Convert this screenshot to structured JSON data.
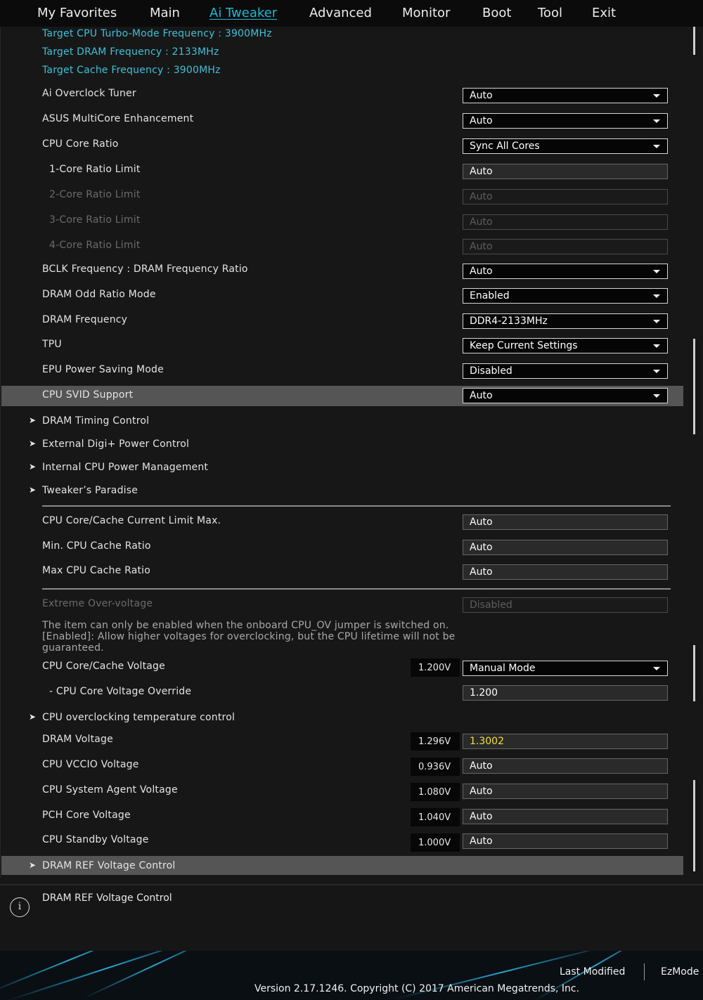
{
  "nav": {
    "tabs": [
      "My Favorites",
      "Main",
      "Ai Tweaker",
      "Advanced",
      "Monitor",
      "Boot",
      "Tool",
      "Exit"
    ],
    "active_tab": "Ai Tweaker"
  },
  "info_lines": [
    "Target CPU Turbo-Mode Frequency : 3900MHz",
    "Target DRAM Frequency : 2133MHz",
    "Target Cache Frequency : 3900MHz"
  ],
  "settings": [
    {
      "label": "Ai Overclock Tuner",
      "value": "Auto"
    },
    {
      "label": "ASUS MultiCore Enhancement",
      "value": "Auto"
    },
    {
      "label": "CPU Core Ratio",
      "value": "Sync All Cores"
    },
    {
      "label": "1-Core Ratio Limit",
      "value": "Auto"
    },
    {
      "label": "2-Core Ratio Limit",
      "value": "Auto"
    },
    {
      "label": "3-Core Ratio Limit",
      "value": "Auto"
    },
    {
      "label": "4-Core Ratio Limit",
      "value": "Auto"
    },
    {
      "label": "BCLK Frequency : DRAM Frequency Ratio",
      "value": "Auto"
    },
    {
      "label": "DRAM Odd Ratio Mode",
      "value": "Enabled"
    },
    {
      "label": "DRAM Frequency",
      "value": "DDR4-2133MHz"
    },
    {
      "label": "TPU",
      "value": "Keep Current Settings"
    },
    {
      "label": "EPU Power Saving Mode",
      "value": "Disabled"
    },
    {
      "label": "CPU SVID Support",
      "value": "Auto"
    }
  ],
  "submenus_1": [
    "DRAM Timing Control",
    "External Digi+ Power Control",
    "Internal CPU Power Management",
    "Tweaker’s Paradise"
  ],
  "cache_settings": [
    {
      "label": "CPU Core/Cache Current Limit Max.",
      "value": "Auto"
    },
    {
      "label": "Min. CPU Cache Ratio",
      "value": "Auto"
    },
    {
      "label": "Max CPU Cache Ratio",
      "value": "Auto"
    }
  ],
  "extreme_ov": {
    "label": "Extreme Over-voltage",
    "value": "Disabled",
    "help_lines": [
      "The item can only be enabled when the onboard CPU_OV jumper is switched on.",
      "[Enabled]: Allow higher voltages for overclocking, but the CPU lifetime will not be",
      "guaranteed."
    ]
  },
  "core_voltage": {
    "label": "CPU Core/Cache Voltage",
    "reading": "1.200V",
    "value": "Manual Mode"
  },
  "core_override": {
    "label": "- CPU Core Voltage Override",
    "value": "1.200"
  },
  "temp_submenu": "CPU overclocking temperature control",
  "voltages": [
    {
      "label": "DRAM Voltage",
      "reading": "1.296V",
      "value": "1.3002"
    },
    {
      "label": "CPU VCCIO Voltage",
      "reading": "0.936V",
      "value": "Auto"
    },
    {
      "label": "CPU System Agent Voltage",
      "reading": "1.080V",
      "value": "Auto"
    },
    {
      "label": "PCH Core Voltage",
      "reading": "1.040V",
      "value": "Auto"
    },
    {
      "label": "CPU Standby Voltage",
      "reading": "1.000V",
      "value": "Auto"
    }
  ],
  "dram_ref_submenu": "DRAM REF Voltage Control",
  "description": {
    "icon": "info-icon",
    "text": "DRAM REF Voltage Control"
  },
  "footer": {
    "last_modified": "Last Modified",
    "ezmode": "EzMode",
    "copyright": "Version 2.17.1246. Copyright (C) 2017 American Megatrends, Inc."
  },
  "colors": {
    "accent": "#1fb9d4",
    "info_text": "#3ec1d8",
    "highlight_row": "#555555",
    "modified_value": "#f2e13a"
  }
}
